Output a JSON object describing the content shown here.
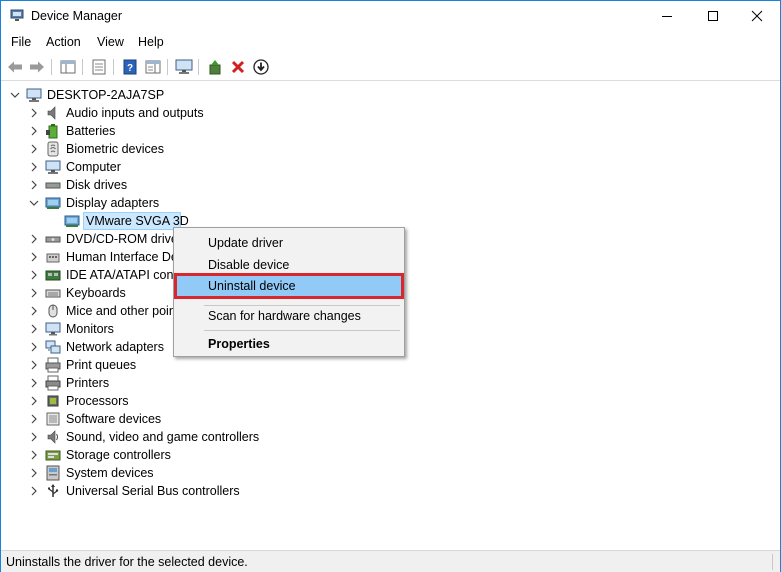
{
  "window": {
    "title": "Device Manager"
  },
  "menu": {
    "file": "File",
    "action": "Action",
    "view": "View",
    "help": "Help"
  },
  "tree": {
    "root": "DESKTOP-2AJA7SP",
    "categories": [
      {
        "label": "Audio inputs and outputs",
        "icon": "speaker-icon"
      },
      {
        "label": "Batteries",
        "icon": "battery-icon"
      },
      {
        "label": "Biometric devices",
        "icon": "fingerprint-icon"
      },
      {
        "label": "Computer",
        "icon": "computer-icon"
      },
      {
        "label": "Disk drives",
        "icon": "disk-drive-icon"
      },
      {
        "label": "Display adapters",
        "icon": "display-adapter-icon",
        "expanded": true
      },
      {
        "label": "VMware SVGA 3D",
        "icon": "display-adapter-icon",
        "child": true,
        "selected": true
      },
      {
        "label": "DVD/CD-ROM drive",
        "icon": "dvd-drive-icon"
      },
      {
        "label": "Human Interface De",
        "icon": "hid-icon"
      },
      {
        "label": "IDE ATA/ATAPI contr",
        "icon": "ide-controller-icon"
      },
      {
        "label": "Keyboards",
        "icon": "keyboard-icon"
      },
      {
        "label": "Mice and other poin",
        "icon": "mouse-icon"
      },
      {
        "label": "Monitors",
        "icon": "monitor-icon"
      },
      {
        "label": "Network adapters",
        "icon": "network-adapter-icon"
      },
      {
        "label": "Print queues",
        "icon": "print-queue-icon"
      },
      {
        "label": "Printers",
        "icon": "printer-icon"
      },
      {
        "label": "Processors",
        "icon": "processor-icon"
      },
      {
        "label": "Software devices",
        "icon": "software-device-icon"
      },
      {
        "label": "Sound, video and game controllers",
        "icon": "sound-icon"
      },
      {
        "label": "Storage controllers",
        "icon": "storage-controller-icon"
      },
      {
        "label": "System devices",
        "icon": "system-device-icon"
      },
      {
        "label": "Universal Serial Bus controllers",
        "icon": "usb-icon"
      }
    ]
  },
  "context_menu": {
    "update_driver": "Update driver",
    "disable_device": "Disable device",
    "uninstall_device": "Uninstall device",
    "scan_hardware": "Scan for hardware changes",
    "properties": "Properties",
    "highlight_color": "#91c9f7",
    "outline_color": "#d9272e"
  },
  "status": {
    "text": "Uninstalls the driver for the selected device."
  }
}
